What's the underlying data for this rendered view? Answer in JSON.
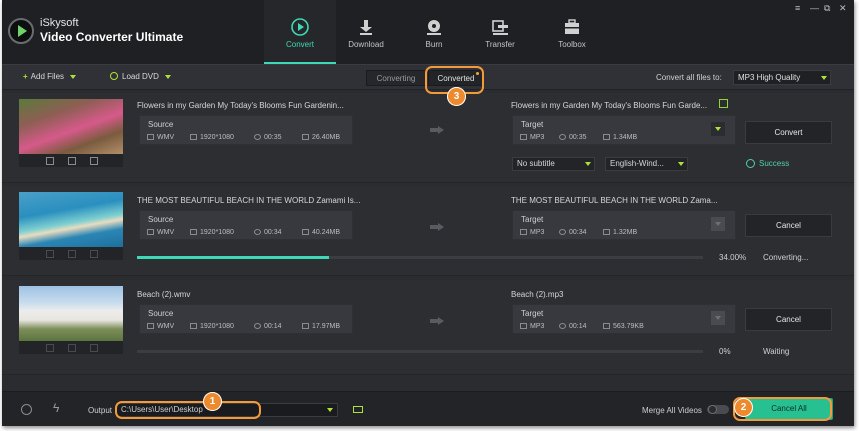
{
  "app": {
    "brand_line1": "iSkysoft",
    "brand_line2": "Video Converter Ultimate",
    "accent_color": "#3fd8b6"
  },
  "nav": [
    {
      "label": "Convert",
      "icon": "convert-icon",
      "active": true
    },
    {
      "label": "Download",
      "icon": "download-icon"
    },
    {
      "label": "Burn",
      "icon": "burn-icon"
    },
    {
      "label": "Transfer",
      "icon": "transfer-icon"
    },
    {
      "label": "Toolbox",
      "icon": "toolbox-icon"
    }
  ],
  "window_controls": {
    "menu": "≡",
    "minimize": "—",
    "restore": "⧉",
    "close": "✕"
  },
  "toolbar": {
    "add_files": "Add Files",
    "load_dvd": "Load DVD",
    "tab_converting": "Converting",
    "tab_converted": "Converted",
    "convert_all_label": "Convert all files to:",
    "convert_all_value": "MP3 High Quality"
  },
  "items": [
    {
      "source_name": "Flowers in my Garden  My Today's Blooms  Fun Gardenin...",
      "target_name": "Flowers in my Garden  My Today's Blooms  Fun Garde...",
      "source_label": "Source",
      "source_format": "WMV",
      "source_resolution": "1920*1080",
      "source_duration": "00:35",
      "source_size": "26.40MB",
      "target_label": "Target",
      "target_format": "MP3",
      "target_duration": "00:35",
      "target_size": "1.34MB",
      "subtitle": "No subtitle",
      "audio": "English-Wind...",
      "action": "Convert",
      "status": "Success"
    },
    {
      "source_name": "THE MOST BEAUTIFUL BEACH IN THE WORLD  Zamami Is...",
      "target_name": "THE MOST BEAUTIFUL BEACH IN THE WORLD  Zama...",
      "source_label": "Source",
      "source_format": "WMV",
      "source_resolution": "1920*1080",
      "source_duration": "00:34",
      "source_size": "40.24MB",
      "target_label": "Target",
      "target_format": "MP3",
      "target_duration": "00:34",
      "target_size": "1.32MB",
      "progress_percent": 34.0,
      "progress_text": "34.00%",
      "action": "Cancel",
      "status": "Converting..."
    },
    {
      "source_name": "Beach (2).wmv",
      "target_name": "Beach (2).mp3",
      "source_label": "Source",
      "source_format": "WMV",
      "source_resolution": "1920*1080",
      "source_duration": "00:14",
      "source_size": "17.97MB",
      "target_label": "Target",
      "target_format": "MP3",
      "target_duration": "00:14",
      "target_size": "563.79KB",
      "progress_percent": 0,
      "progress_text": "0%",
      "action": "Cancel",
      "status": "Waiting"
    }
  ],
  "bottom": {
    "output_label": "Output",
    "output_path": "C:\\Users\\User\\Desktop",
    "merge_label": "Merge All Videos",
    "merge_on": false,
    "cancel_all": "Cancel All"
  },
  "callouts": [
    "1",
    "2",
    "3"
  ],
  "callout_color": "#f59a3a"
}
